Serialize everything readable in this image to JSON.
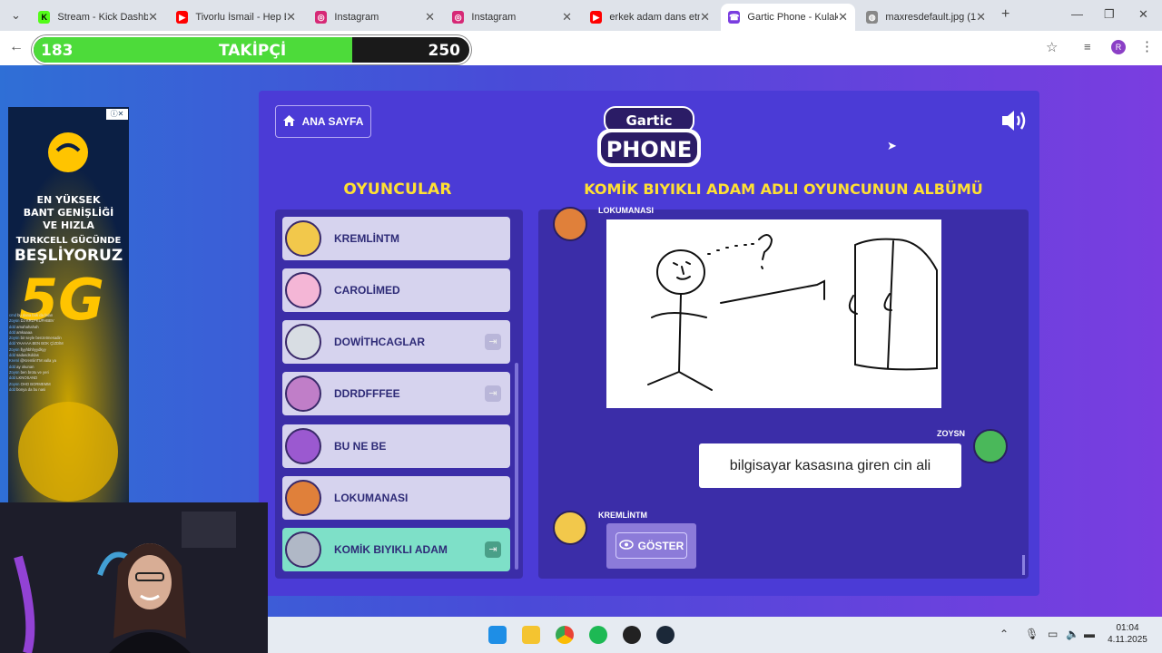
{
  "browser": {
    "tabs": [
      {
        "title": "Stream - Kick Dashbo",
        "icon": "kick-icon",
        "color": "#53fc18"
      },
      {
        "title": "Tivorlu İsmail - Hep E",
        "icon": "youtube-icon",
        "color": "#ff0000"
      },
      {
        "title": "Instagram",
        "icon": "instagram-icon",
        "color": "#d62976"
      },
      {
        "title": "Instagram",
        "icon": "instagram-icon",
        "color": "#d62976"
      },
      {
        "title": "erkek adam dans etm",
        "icon": "youtube-icon",
        "color": "#ff0000"
      },
      {
        "title": "Gartic Phone - Kulak",
        "icon": "gartic-icon",
        "color": "#7a3de0"
      },
      {
        "title": "maxresdefault.jpg (1",
        "icon": "globe-icon",
        "color": "#888888"
      }
    ],
    "profile_initial": "R"
  },
  "follower_bar": {
    "current": "183",
    "label": "TAKİPÇİ",
    "goal": "250",
    "progress": 0.732
  },
  "game": {
    "home_label": "ANA SAYFA",
    "players_heading": "OYUNCULAR",
    "album_heading": "KOMİK BIYIKLI ADAM ADLI OYUNCUNUN ALBÜMÜ",
    "players": [
      {
        "name": "KREMLİNTM",
        "color": "#f2c84b",
        "kick": false,
        "active": false
      },
      {
        "name": "CAROLİMED",
        "color": "#f4b6d6",
        "kick": false,
        "active": false
      },
      {
        "name": "DOWİTHCAGLAR",
        "color": "#d8dde3",
        "kick": true,
        "active": false
      },
      {
        "name": "DDRDFFFEE",
        "color": "#c07ec8",
        "kick": true,
        "active": false
      },
      {
        "name": "BU NE BE",
        "color": "#9b59d0",
        "kick": false,
        "active": false
      },
      {
        "name": "LOKUMANASI",
        "color": "#e0803a",
        "kick": false,
        "active": false
      },
      {
        "name": "KOMİK BIYIKLI ADAM",
        "color": "#b0b8c6",
        "kick": true,
        "active": true
      }
    ],
    "album": {
      "drawing_author": "LOKUMANASI",
      "guess_author": "ZOYSN",
      "guess_text": "bilgisayar kasasına giren cin ali",
      "pending_author": "KREMLİNTM",
      "show_label": "GÖSTER"
    }
  },
  "ad": {
    "line1": "EN YÜKSEK",
    "line2": "BANT GENİŞLİĞİ",
    "line3": "VE HIZLA",
    "line4": "TURKCELL GÜCÜNDE",
    "line5": "BEŞLİYORUZ",
    "badge": "5G",
    "brand_color": "#ffc400"
  },
  "chat": [
    {
      "user": "cmd",
      "msg": "bu dana bok da falan"
    },
    {
      "user": "Zoysn",
      "msg": "DJ KRLPKUFHBBV"
    },
    {
      "user": "ddd",
      "msg": "amahahahah"
    },
    {
      "user": "ddd",
      "msg": "amkaaaa"
    },
    {
      "user": "Zoysn",
      "msg": "bir seyle benzetmesadin"
    },
    {
      "user": "ddd",
      "msg": "YAAAAA BEN BOK ÇİZDİM"
    },
    {
      "user": "Zoysn",
      "msg": "llyyhbhhyydkyy"
    },
    {
      "user": "ddd",
      "msg": "sadasdsddas"
    },
    {
      "user": "Kreml",
      "msg": "@KremlinTM valla ya"
    },
    {
      "user": "ddd",
      "msg": "ay okunan"
    },
    {
      "user": "Zoysn",
      "msg": "ben brotu ve yeri"
    },
    {
      "user": "ddd",
      "msg": "LKNOSAND"
    },
    {
      "user": "Zoysn",
      "msg": "OHO BORMEMM"
    },
    {
      "user": "ddd",
      "msg": "bonya da bu nasi"
    }
  ],
  "taskbar": {
    "time": "01:04",
    "date": "4.11.2025"
  }
}
